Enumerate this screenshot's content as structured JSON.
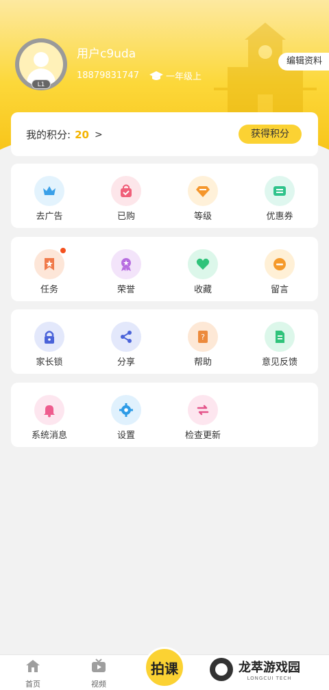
{
  "profile": {
    "username": "用户c9uda",
    "phone": "18879831747",
    "grade": "一年级上",
    "level": "L1",
    "edit_label": "编辑资料"
  },
  "points": {
    "label": "我的积分:",
    "value": "20",
    "arrow": ">",
    "earn_label": "获得积分"
  },
  "grid": {
    "row1": [
      {
        "label": "去广告",
        "icon": "crown-icon"
      },
      {
        "label": "已购",
        "icon": "shopping-bag-icon"
      },
      {
        "label": "等级",
        "icon": "diamond-icon"
      },
      {
        "label": "优惠券",
        "icon": "coupon-icon"
      }
    ],
    "row2": [
      {
        "label": "任务",
        "icon": "task-star-icon"
      },
      {
        "label": "荣誉",
        "icon": "medal-icon"
      },
      {
        "label": "收藏",
        "icon": "heart-icon"
      },
      {
        "label": "留言",
        "icon": "message-icon"
      }
    ],
    "row3": [
      {
        "label": "家长锁",
        "icon": "lock-icon"
      },
      {
        "label": "分享",
        "icon": "share-icon"
      },
      {
        "label": "帮助",
        "icon": "help-book-icon"
      },
      {
        "label": "意见反馈",
        "icon": "feedback-doc-icon"
      }
    ],
    "row4": [
      {
        "label": "系统消息",
        "icon": "bell-icon"
      },
      {
        "label": "设置",
        "icon": "gear-icon"
      },
      {
        "label": "检查更新",
        "icon": "refresh-arrows-icon"
      }
    ]
  },
  "tabbar": {
    "home": "首页",
    "video": "视频",
    "center": "拍课"
  },
  "watermark": {
    "cn": "龙萃游戏园",
    "en": "LONGCUI TECH"
  },
  "colors": {
    "accent": "#fbd233",
    "points": "#f4b400"
  }
}
